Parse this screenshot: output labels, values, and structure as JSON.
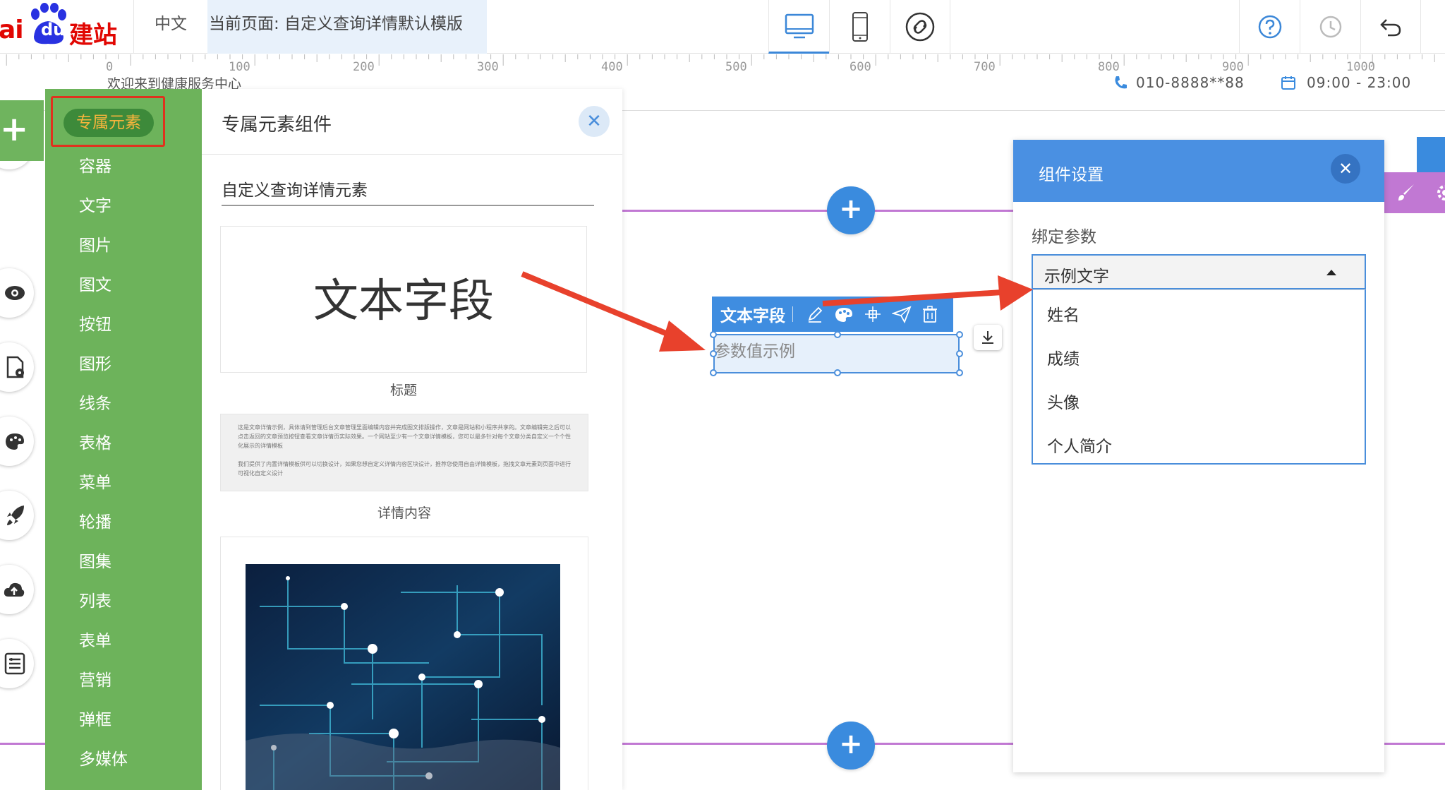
{
  "header": {
    "logo_ai": "ai",
    "logo_du": "du",
    "logo_jz": "建站",
    "language": "中文",
    "current_page": "当前页面: 自定义查询详情默认模版",
    "desktop_icon": "desktop-icon",
    "mobile_icon": "mobile-icon",
    "link_icon": "link-icon",
    "help_icon": "help-icon",
    "history_icon": "history-icon",
    "undo_icon": "undo-icon"
  },
  "ruler": {
    "labels": [
      "0",
      "100",
      "200",
      "300",
      "400",
      "500",
      "600",
      "700",
      "800",
      "900",
      "1000"
    ]
  },
  "canvas": {
    "welcome": "欢迎来到健康服务中心",
    "phone": "010-8888**88",
    "hours": "09:00 - 23:00",
    "selected_element": {
      "toolbar_label": "文本字段",
      "text": "参数值示例"
    }
  },
  "category_panel": {
    "selected": "专属元素",
    "items": [
      "容器",
      "文字",
      "图片",
      "图文",
      "按钮",
      "图形",
      "线条",
      "表格",
      "菜单",
      "轮播",
      "图集",
      "列表",
      "表单",
      "营销",
      "弹框",
      "多媒体"
    ]
  },
  "element_panel": {
    "title": "专属元素组件",
    "close_icon": "close-icon",
    "subtitle": "自定义查询详情元素",
    "cards": [
      {
        "preview_text": "文本字段",
        "label": "标题"
      },
      {
        "preview_text": "这是文章详情示例，具体请到管理后台文章管理里面编辑内容并完成图文排版操作，文章是网站和小程序共享的。文章编辑完之后可以点击返回的文章预览按钮查看文章详情页实际效果。一个网站至少有一个文章详情模板，您可以最多针对每个文章分类自定义一个个性化展示的详情模板\n\n我们提供了内置详情模板供可以切换设计，如果您想自定义详情内容区块设计，推荐您使用自由详情模板，拖拽文章元素到页面中进行可视化自定义设计",
        "label": "详情内容"
      },
      {
        "preview_text": "",
        "label": ""
      }
    ]
  },
  "settings_panel": {
    "title": "组件设置",
    "bind_label": "绑定参数",
    "selected_value": "示例文字",
    "options": [
      "姓名",
      "成绩",
      "头像",
      "个人简介"
    ]
  },
  "colors": {
    "accent_blue": "#3a8bde",
    "panel_green": "#6db35b",
    "annotation_red": "#e0321e",
    "purple_line": "#c178d3"
  }
}
